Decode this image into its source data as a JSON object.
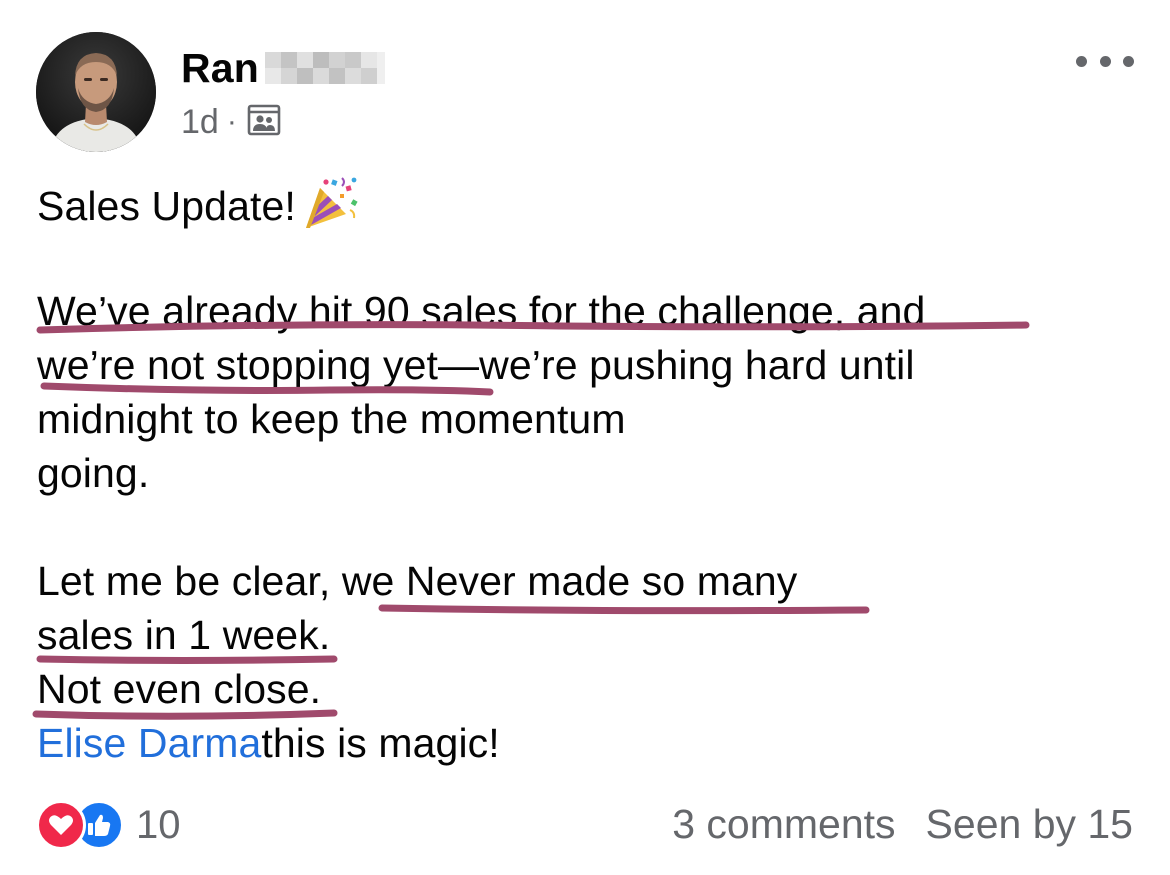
{
  "post": {
    "author": {
      "name_visible": "Ran",
      "avatar": "profile-photo"
    },
    "timestamp": "1d",
    "separator": "·",
    "audience_icon": "group-members-icon",
    "more_icon": "more-options-icon",
    "body": {
      "headline": "Sales Update!",
      "headline_emoji": "party-popper-emoji",
      "paragraph1": [
        "We’ve already hit 90 sales for the challenge, and",
        "we’re not stopping yet—we’re pushing hard until",
        "midnight to keep the momentum",
        "going."
      ],
      "paragraph2": [
        "Let me be clear, we Never made so many",
        "sales in 1 week.",
        "Not even close."
      ],
      "mention": "Elise Darma",
      "mention_trailing": "this is magic!"
    },
    "annotations": {
      "type": "hand-drawn underlines",
      "color": "#a04a6c"
    },
    "footer": {
      "reactions": [
        "love-reaction-icon",
        "like-reaction-icon"
      ],
      "reaction_count": "10",
      "comments": "3 comments",
      "seen_by": "Seen by 15"
    }
  },
  "colors": {
    "text": "#050505",
    "secondary": "#65676b",
    "mention": "#216fdb",
    "like": "#1877f2",
    "love": "#f0284a"
  }
}
